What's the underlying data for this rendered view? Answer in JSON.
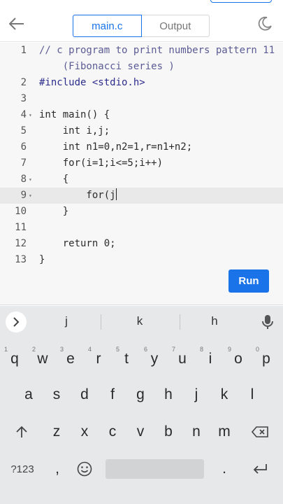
{
  "header": {
    "back_icon": "arrow-left-icon",
    "tabs": [
      {
        "label": "main.c",
        "active": true
      },
      {
        "label": "Output",
        "active": false
      }
    ],
    "theme_icon": "moon-icon"
  },
  "editor": {
    "lines": [
      {
        "num": "1",
        "fold": "",
        "text": "// c program to print numbers pattern 11"
      },
      {
        "num": "",
        "fold": "",
        "text": "    (Fibonacci series )"
      },
      {
        "num": "2",
        "fold": "",
        "text": "#include <stdio.h>"
      },
      {
        "num": "3",
        "fold": "",
        "text": ""
      },
      {
        "num": "4",
        "fold": "▾",
        "text": "int main() {"
      },
      {
        "num": "5",
        "fold": "",
        "text": "    int i,j;"
      },
      {
        "num": "6",
        "fold": "",
        "text": "    int n1=0,n2=1,r=n1+n2;"
      },
      {
        "num": "7",
        "fold": "",
        "text": "    for(i=1;i<=5;i++)"
      },
      {
        "num": "8",
        "fold": "▾",
        "text": "    {"
      },
      {
        "num": "9",
        "fold": "▾",
        "text": "        for(j"
      },
      {
        "num": "10",
        "fold": "",
        "text": "    }"
      },
      {
        "num": "11",
        "fold": "",
        "text": ""
      },
      {
        "num": "12",
        "fold": "",
        "text": "    return 0;"
      },
      {
        "num": "13",
        "fold": "",
        "text": "}"
      }
    ],
    "active_line": "9",
    "run_label": "Run",
    "accent": "#1a73e8"
  },
  "keyboard": {
    "suggestions": [
      "j",
      "k",
      "h"
    ],
    "expand_icon": "chevron-right-icon",
    "mic_icon": "mic-icon",
    "row1": [
      {
        "key": "q",
        "hint": "1"
      },
      {
        "key": "w",
        "hint": "2"
      },
      {
        "key": "e",
        "hint": "3"
      },
      {
        "key": "r",
        "hint": "4"
      },
      {
        "key": "t",
        "hint": "5"
      },
      {
        "key": "y",
        "hint": "6"
      },
      {
        "key": "u",
        "hint": "7"
      },
      {
        "key": "i",
        "hint": "8"
      },
      {
        "key": "o",
        "hint": "9"
      },
      {
        "key": "p",
        "hint": "0"
      }
    ],
    "row2": [
      "a",
      "s",
      "d",
      "f",
      "g",
      "h",
      "j",
      "k",
      "l"
    ],
    "row3": [
      "z",
      "x",
      "c",
      "v",
      "b",
      "n",
      "m"
    ],
    "shift_icon": "shift-arrow-icon",
    "backspace_icon": "backspace-icon",
    "symbols_label": "?123",
    "comma_label": ",",
    "emoji_icon": "emoji-icon",
    "period_label": ".",
    "enter_icon": "enter-icon"
  }
}
